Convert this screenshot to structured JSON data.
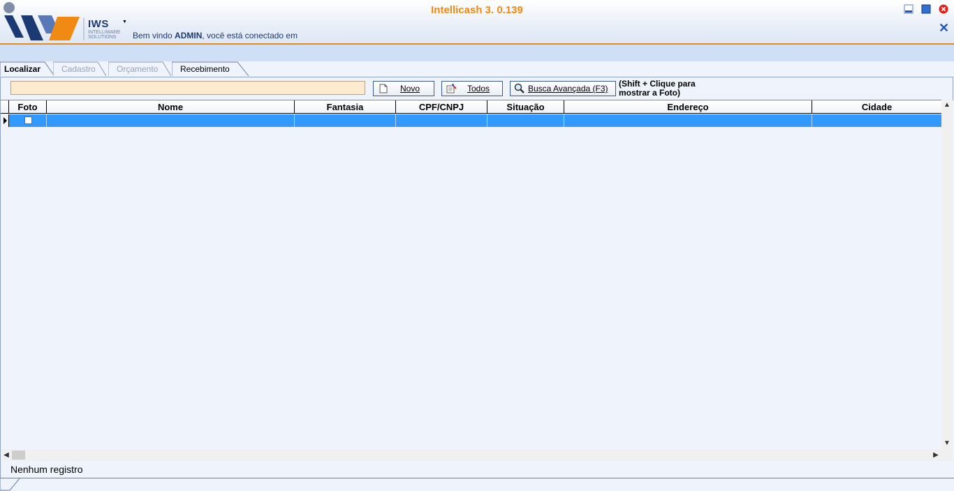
{
  "header": {
    "app_title": "Intellicash 3. 0.139",
    "logo_text": "IWS",
    "logo_sub": "INTELLIWARE SOLUTIONS",
    "welcome_prefix": "Bem vindo ",
    "welcome_user": "ADMIN",
    "welcome_suffix": ", você está conectado em",
    "window_controls": [
      "minimize-icon",
      "maximize-icon",
      "close-icon",
      "close-x-icon"
    ],
    "colors": {
      "title": "#f08a13",
      "accent_line": "#e58a1c",
      "brand_blue": "#1b3a73"
    }
  },
  "tabs": [
    {
      "label": "Localizar",
      "state": "active"
    },
    {
      "label": "Cadastro",
      "state": "disabled"
    },
    {
      "label": "Orçamento",
      "state": "disabled"
    },
    {
      "label": "Recebimento",
      "state": "enabled"
    }
  ],
  "toolbar": {
    "search_value": "",
    "novo_label": "Novo",
    "todos_label": "Todos",
    "busca_label": "Busca Avançada (F3)",
    "hint_line1": "(Shift + Clique para",
    "hint_line2": "mostrar a Foto)"
  },
  "grid": {
    "columns": [
      "Foto",
      "Nome",
      "Fantasia",
      "CPF/CNPJ",
      "Situação",
      "Endereço",
      "Cidade"
    ],
    "selected_row_color": "#3399ff"
  },
  "status": {
    "text": "Nenhum registro"
  }
}
